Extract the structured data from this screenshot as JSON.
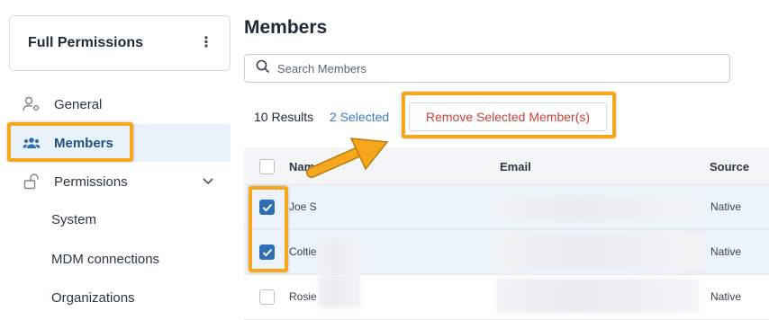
{
  "sidebar": {
    "role_title": "Full Permissions",
    "kebab": "⋮",
    "items": [
      {
        "label": "General",
        "icon": "user-settings-icon"
      },
      {
        "label": "Members",
        "icon": "group-icon",
        "active": true
      },
      {
        "label": "Permissions",
        "icon": "lock-icon"
      }
    ],
    "subitems": [
      {
        "label": "System"
      },
      {
        "label": "MDM connections"
      },
      {
        "label": "Organizations"
      }
    ]
  },
  "main": {
    "title": "Members",
    "search": {
      "placeholder": "Search Members",
      "value": ""
    },
    "results_text": "10 Results",
    "selected_text": "2 Selected",
    "remove_button": "Remove Selected Member(s)",
    "columns": [
      "Name",
      "Email",
      "Source"
    ],
    "rows": [
      {
        "name": "Joe S",
        "email": "",
        "source": "Native",
        "checked": true
      },
      {
        "name": "Coltie",
        "email": "",
        "source": "Native",
        "checked": true
      },
      {
        "name": "Rosie",
        "email": "",
        "source": "Native",
        "checked": false
      }
    ]
  },
  "colors": {
    "accent": "#2f6eb3",
    "highlight": "#f6a71b",
    "danger": "#c7423a",
    "active_bg": "#e9f1fb"
  }
}
